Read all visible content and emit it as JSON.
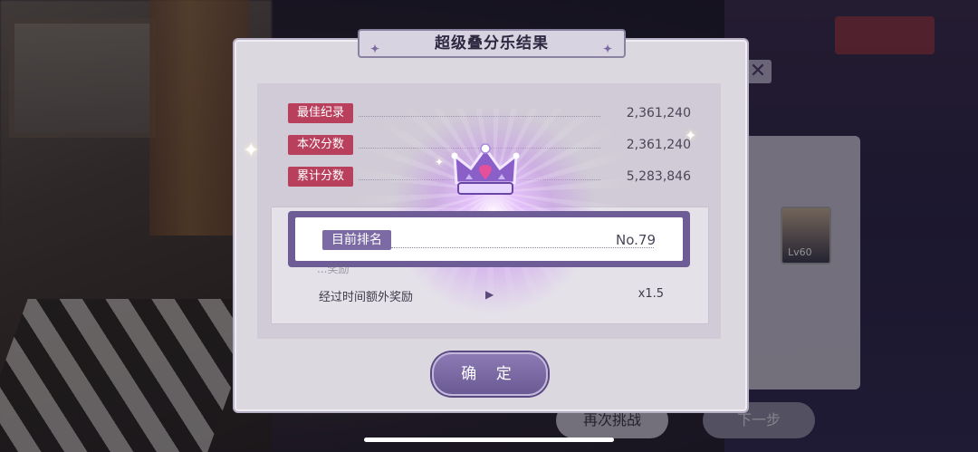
{
  "background": {
    "retry_button": "再次挑战",
    "next_button": "下一步",
    "card_level": "Lv60",
    "close_glyph": "✕"
  },
  "dialog": {
    "title": "超级叠分乐结果",
    "scores": [
      {
        "label": "最佳纪录",
        "value": "2,361,240"
      },
      {
        "label": "本次分数",
        "value": "2,361,240"
      },
      {
        "label": "累计分数",
        "value": "5,283,846"
      }
    ],
    "ranking": {
      "label": "目前排名",
      "value": "No.79"
    },
    "rewards": {
      "hidden_row": "...奖励",
      "bonus_label": "经过时间额外奖励",
      "bonus_value": "x1.5"
    },
    "confirm_button": "确 定"
  },
  "colors": {
    "accent_purple": "#6e5c96",
    "score_label_red": "#b8405c",
    "dialog_bg": "#dcd8e0"
  },
  "icons": [
    "crown-icon",
    "sparkle-icon",
    "play-arrow-icon",
    "close-icon"
  ]
}
